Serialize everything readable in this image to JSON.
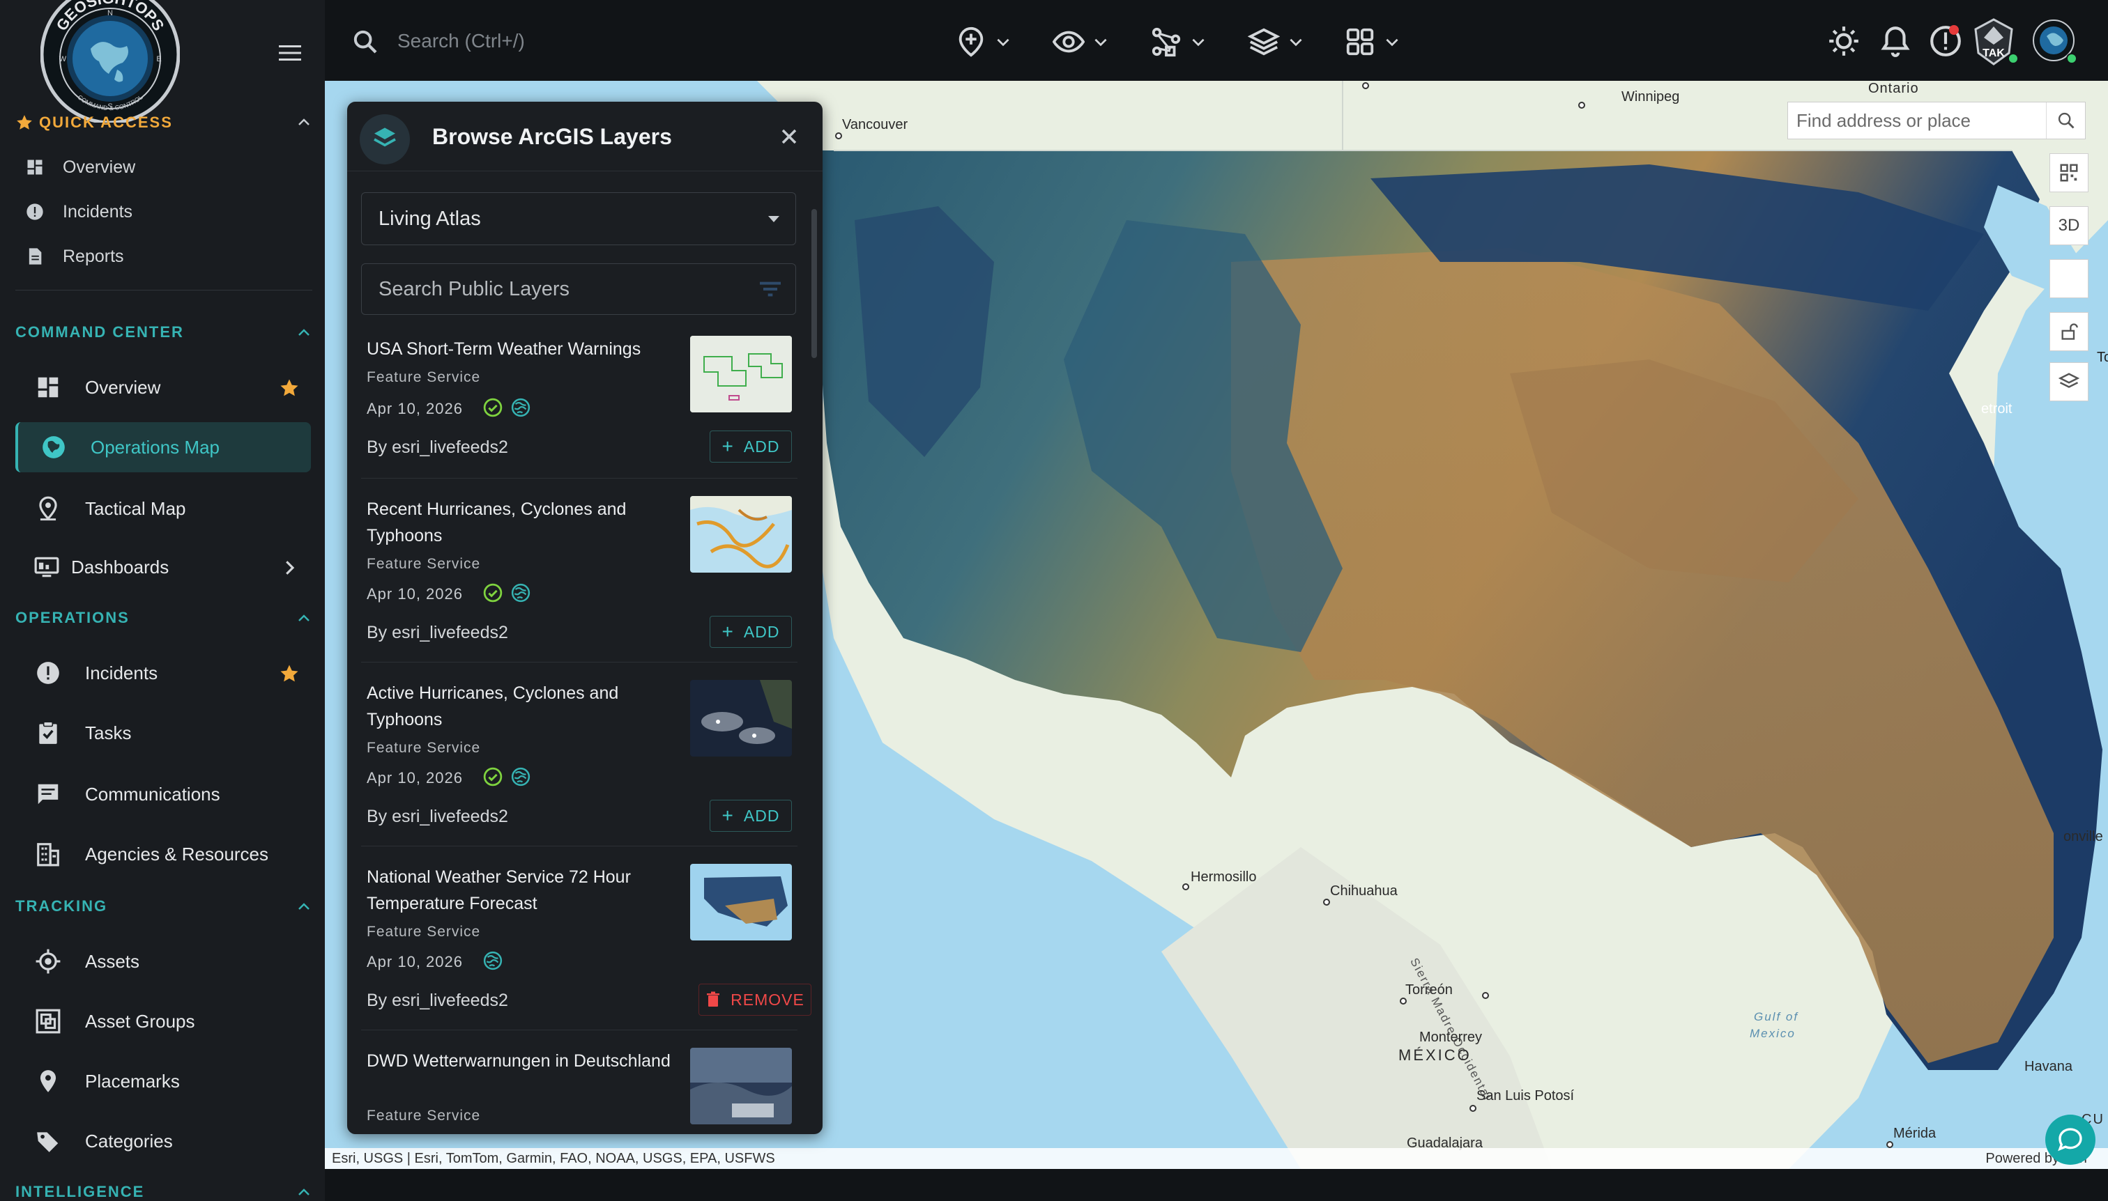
{
  "sidebar": {
    "quick_access": {
      "title": "QUICK ACCESS",
      "items": [
        {
          "label": "Overview"
        },
        {
          "label": "Incidents"
        },
        {
          "label": "Reports"
        }
      ]
    },
    "sections": [
      {
        "title": "COMMAND CENTER"
      },
      {
        "title": "OPERATIONS"
      },
      {
        "title": "TRACKING"
      },
      {
        "title": "INTELLIGENCE"
      }
    ],
    "command_center": [
      {
        "label": "Overview",
        "starred": true
      },
      {
        "label": "Operations Map",
        "active": true
      },
      {
        "label": "Tactical Map"
      },
      {
        "label": "Dashboards",
        "has_children": true
      }
    ],
    "operations": [
      {
        "label": "Incidents",
        "starred": true
      },
      {
        "label": "Tasks"
      },
      {
        "label": "Communications"
      },
      {
        "label": "Agencies & Resources"
      }
    ],
    "tracking": [
      {
        "label": "Assets"
      },
      {
        "label": "Asset Groups"
      },
      {
        "label": "Placemarks"
      },
      {
        "label": "Categories"
      }
    ],
    "logo_text": "GEOSIGHTOPS",
    "logo_subtext": "COMMAND & CONTROL"
  },
  "topbar": {
    "search_placeholder": "Search (Ctrl+/)",
    "tak_label": "TAK"
  },
  "panel": {
    "title": "Browse ArcGIS Layers",
    "source_select": "Living Atlas",
    "search_placeholder": "Search Public Layers",
    "layers": [
      {
        "title": "USA Short-Term Weather Warnings",
        "type": "Feature Service",
        "date": "Apr 10, 2026",
        "verified": true,
        "public": true,
        "owner": "By esri_livefeeds2",
        "action": "ADD"
      },
      {
        "title": "Recent Hurricanes, Cyclones and Typhoons",
        "type": "Feature Service",
        "date": "Apr 10, 2026",
        "verified": true,
        "public": true,
        "owner": "By esri_livefeeds2",
        "action": "ADD"
      },
      {
        "title": "Active Hurricanes, Cyclones and Typhoons",
        "type": "Feature Service",
        "date": "Apr 10, 2026",
        "verified": true,
        "public": true,
        "owner": "By esri_livefeeds2",
        "action": "ADD"
      },
      {
        "title": "National Weather Service 72 Hour Temperature Forecast",
        "type": "Feature Service",
        "date": "Apr 10, 2026",
        "verified": false,
        "public": true,
        "owner": "By esri_livefeeds2",
        "action": "REMOVE"
      },
      {
        "title": "DWD Wetterwarnungen in Deutschland",
        "type": "Feature Service"
      }
    ]
  },
  "map": {
    "search_placeholder": "Find address or place",
    "btn_3d": "3D",
    "attribution": "Esri, USGS | Esri, TomTom, Garmin, FAO, NOAA, USGS, EPA, USFWS",
    "powered": "Powered by Esri",
    "labels": {
      "ontario": "Ontario",
      "winnipeg": "Winnipeg",
      "vancouver": "Vancouver",
      "hermosillo": "Hermosillo",
      "chihuahua": "Chihuahua",
      "torreon": "Torreón",
      "monterrey": "Monterrey",
      "mexico": "MÉXICO",
      "san_luis": "San Luis Potosí",
      "guadalajara": "Guadalajara",
      "merida": "Mérida",
      "havana": "Havana",
      "gulf": "Gulf of",
      "gulf2": "Mexico",
      "sierra": "Sierra Madre Occidental",
      "detroit": "etroit",
      "onville": "onville",
      "to": "To",
      "cu": "CU"
    }
  },
  "colors": {
    "accent": "#36b3b3",
    "quick_access": "#f2a93b",
    "star": "#f2a93b",
    "remove": "#f04848",
    "verified": "#7fd33f"
  }
}
